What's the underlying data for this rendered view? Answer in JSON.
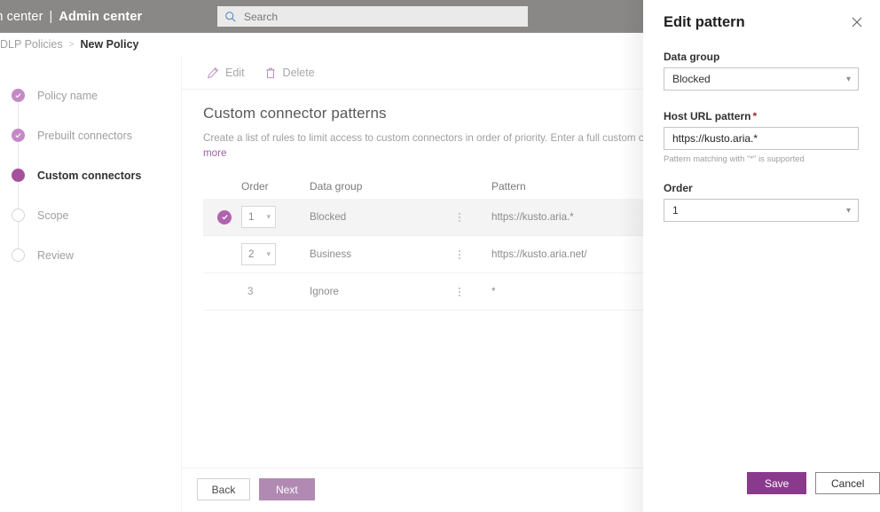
{
  "topbar": {
    "brand_partial": "in center",
    "brand_separator": "|",
    "brand_main": "Admin center",
    "search_placeholder": "Search",
    "search_value": "",
    "search_icon": "search-icon",
    "background": "#8a8886"
  },
  "breadcrumb": {
    "parent": "DLP Policies",
    "separator": ">",
    "current": "New Policy"
  },
  "wizard": {
    "steps": [
      {
        "label": "Policy name",
        "state": "done"
      },
      {
        "label": "Prebuilt connectors",
        "state": "done"
      },
      {
        "label": "Custom connectors",
        "state": "current"
      },
      {
        "label": "Scope",
        "state": "todo"
      },
      {
        "label": "Review",
        "state": "todo"
      }
    ]
  },
  "toolbar": {
    "edit_label": "Edit",
    "edit_icon": "pencil-icon",
    "delete_label": "Delete",
    "delete_icon": "trash-icon"
  },
  "main": {
    "title": "Custom connector patterns",
    "description": "Create a list of rules to limit access to custom connectors in order of priority. Enter a full custom connector U",
    "description_link": "more",
    "table": {
      "columns": [
        "Order",
        "Data group",
        "Pattern"
      ],
      "rows": [
        {
          "selected": true,
          "order": "1",
          "order_is_select": true,
          "data_group": "Blocked",
          "pattern": "https://kusto.aria.*"
        },
        {
          "selected": false,
          "order": "2",
          "order_is_select": true,
          "data_group": "Business",
          "pattern": "https://kusto.aria.net/"
        },
        {
          "selected": false,
          "order": "3",
          "order_is_select": false,
          "data_group": "Ignore",
          "pattern": "*"
        }
      ]
    }
  },
  "footer": {
    "back_label": "Back",
    "next_label": "Next",
    "next_color": "#b18ab3"
  },
  "panel": {
    "title": "Edit pattern",
    "close_icon": "close-icon",
    "data_group": {
      "label": "Data group",
      "value": "Blocked",
      "chevron_icon": "chevron-down-icon"
    },
    "host_url": {
      "label": "Host URL pattern",
      "required_marker": "*",
      "value": "https://kusto.aria.*",
      "placeholder": "",
      "hint": "Pattern matching with \"*\" is supported"
    },
    "order": {
      "label": "Order",
      "value": "1",
      "chevron_icon": "chevron-down-icon"
    },
    "save_label": "Save",
    "cancel_label": "Cancel",
    "save_color": "#8a3a8c"
  }
}
